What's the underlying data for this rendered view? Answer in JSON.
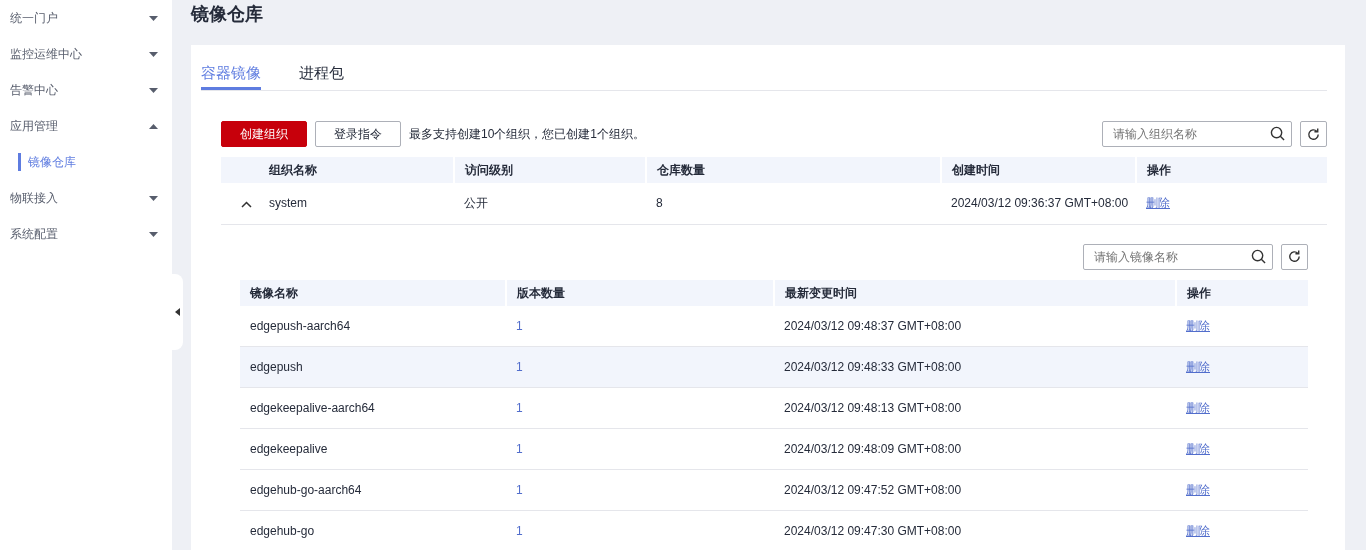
{
  "sidebar": {
    "items": [
      {
        "label": "统一门户",
        "expanded": false
      },
      {
        "label": "监控运维中心",
        "expanded": false
      },
      {
        "label": "告警中心",
        "expanded": false
      },
      {
        "label": "应用管理",
        "expanded": true,
        "children": [
          {
            "label": "镜像仓库",
            "selected": true
          }
        ]
      },
      {
        "label": "物联接入",
        "expanded": false
      },
      {
        "label": "系统配置",
        "expanded": false
      }
    ]
  },
  "page_title": "镜像仓库",
  "tabs": [
    {
      "label": "容器镜像",
      "selected": true
    },
    {
      "label": "进程包",
      "selected": false
    }
  ],
  "toolbar": {
    "buttons": [
      {
        "label": "创建组织",
        "kind": "primary"
      },
      {
        "label": "登录指令",
        "kind": "default"
      }
    ],
    "hint": "最多支持创建10个组织，您已创建1个组织。",
    "search": {
      "placeholder": "请输入组织名称"
    }
  },
  "org_table": {
    "columns": [
      "组织名称",
      "访问级别",
      "仓库数量",
      "创建时间",
      "操作"
    ],
    "rows": [
      {
        "expanded": true,
        "name": "system",
        "access": "公开",
        "count": "8",
        "created": "2024/03/12 09:36:37 GMT+08:00",
        "action": "删除"
      }
    ]
  },
  "image_table": {
    "search": {
      "placeholder": "请输入镜像名称"
    },
    "columns": [
      "镜像名称",
      "版本数量",
      "最新变更时间",
      "操作"
    ],
    "rows": [
      {
        "name": "edgepush-aarch64",
        "versions": "1",
        "changed": "2024/03/12 09:48:37 GMT+08:00",
        "action": "删除",
        "hovered": false
      },
      {
        "name": "edgepush",
        "versions": "1",
        "changed": "2024/03/12 09:48:33 GMT+08:00",
        "action": "删除",
        "hovered": true
      },
      {
        "name": "edgekeepalive-aarch64",
        "versions": "1",
        "changed": "2024/03/12 09:48:13 GMT+08:00",
        "action": "删除",
        "hovered": false
      },
      {
        "name": "edgekeepalive",
        "versions": "1",
        "changed": "2024/03/12 09:48:09 GMT+08:00",
        "action": "删除",
        "hovered": false
      },
      {
        "name": "edgehub-go-aarch64",
        "versions": "1",
        "changed": "2024/03/12 09:47:52 GMT+08:00",
        "action": "删除",
        "hovered": false
      },
      {
        "name": "edgehub-go",
        "versions": "1",
        "changed": "2024/03/12 09:47:30 GMT+08:00",
        "action": "删除",
        "hovered": false
      }
    ]
  }
}
